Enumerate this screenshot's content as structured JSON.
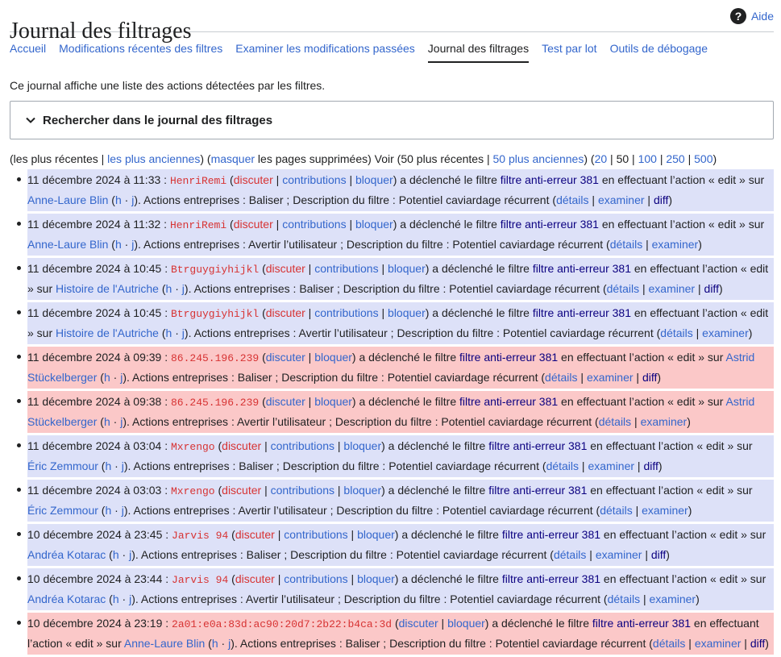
{
  "header": {
    "title": "Journal des filtrages",
    "help_label": "Aide"
  },
  "tabs": [
    {
      "label": "Accueil"
    },
    {
      "label": "Modifications récentes des filtres"
    },
    {
      "label": "Examiner les modifications passées"
    },
    {
      "label": "Journal des filtrages",
      "active": true
    },
    {
      "label": "Test par lot"
    },
    {
      "label": "Outils de débogage"
    }
  ],
  "intro": "Ce journal affiche une liste des actions détectées par les filtres.",
  "search": {
    "label": "Rechercher dans le journal des filtrages"
  },
  "pager": {
    "most_recent": "les plus récentes",
    "oldest": "les plus anciennes",
    "hide": "masquer",
    "hide_rest": " les pages supprimées) Voir (50 plus récentes | ",
    "older50": "50 plus anciennes",
    "limits": [
      "20",
      "50",
      "100",
      "250",
      "500"
    ]
  },
  "colors": {
    "link": "#3366cc",
    "visited": "#0b0080",
    "redlink": "#d73333",
    "row_blue": "#dde1f8",
    "row_pink": "#fbc8c8"
  },
  "entries": [
    {
      "date": "11 décembre 2024 à 11:33",
      "user": "HenriRemi",
      "contribs": true,
      "page": "Anne-Laure Blin",
      "action": "Baliser",
      "diff": true,
      "bg": "blue"
    },
    {
      "date": "11 décembre 2024 à 11:32",
      "user": "HenriRemi",
      "contribs": true,
      "page": "Anne-Laure Blin",
      "action": "Avertir l’utilisateur",
      "diff": false,
      "bg": "blue"
    },
    {
      "date": "11 décembre 2024 à 10:45",
      "user": "Btrguygiyhijkl",
      "contribs": true,
      "page": "Histoire de l'Autriche",
      "action": "Baliser",
      "diff": true,
      "bg": "blue"
    },
    {
      "date": "11 décembre 2024 à 10:45",
      "user": "Btrguygiyhijkl",
      "contribs": true,
      "page": "Histoire de l'Autriche",
      "action": "Avertir l’utilisateur",
      "diff": false,
      "bg": "blue"
    },
    {
      "date": "11 décembre 2024 à 09:39",
      "user": "86.245.196.239",
      "contribs": false,
      "page": "Astrid Stückelberger",
      "action": "Baliser",
      "diff": true,
      "bg": "pink"
    },
    {
      "date": "11 décembre 2024 à 09:38",
      "user": "86.245.196.239",
      "contribs": false,
      "page": "Astrid Stückelberger",
      "action": "Avertir l’utilisateur",
      "diff": false,
      "bg": "pink"
    },
    {
      "date": "11 décembre 2024 à 03:04",
      "user": "Mxrengo",
      "contribs": true,
      "page": "Éric Zemmour",
      "action": "Baliser",
      "diff": true,
      "bg": "blue"
    },
    {
      "date": "11 décembre 2024 à 03:03",
      "user": "Mxrengo",
      "contribs": true,
      "page": "Éric Zemmour",
      "action": "Avertir l’utilisateur",
      "diff": false,
      "bg": "blue"
    },
    {
      "date": "10 décembre 2024 à 23:45",
      "user": "Jarvis 94",
      "contribs": true,
      "page": "Andréa Kotarac",
      "action": "Baliser",
      "diff": true,
      "bg": "blue"
    },
    {
      "date": "10 décembre 2024 à 23:44",
      "user": "Jarvis 94",
      "contribs": true,
      "page": "Andréa Kotarac",
      "action": "Avertir l’utilisateur",
      "diff": false,
      "bg": "blue"
    },
    {
      "date": "10 décembre 2024 à 23:19",
      "user": "2a01:e0a:83d:ac90:20d7:2b22:b4ca:3d",
      "contribs": false,
      "page": "Anne-Laure Blin",
      "action": "Baliser",
      "diff": true,
      "bg": "pink"
    }
  ],
  "strings": {
    "sep": " : ",
    "talk": "discuter",
    "contribs": "contributions",
    "block": "bloquer",
    "triggered": " a déclenché le filtre ",
    "filter": "filtre anti-erreur 381",
    "performing": " en effectuant l’action « edit » sur ",
    "hist": "h",
    "diff_short": "j",
    "actions_taken": "Actions entreprises : ",
    "desc": "Description du filtre : Potentiel caviardage récurrent",
    "details": "détails",
    "examine": "examiner",
    "diff": "diff"
  }
}
